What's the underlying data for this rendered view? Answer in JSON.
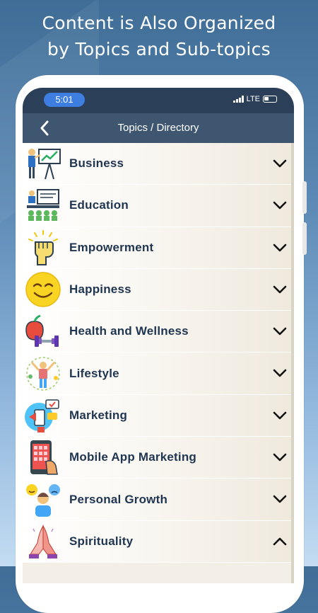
{
  "headline": {
    "line1": "Content is Also Organized",
    "line2": "by Topics and Sub-topics"
  },
  "status_bar": {
    "time": "5:01",
    "network": "LTE"
  },
  "nav": {
    "title": "Topics / Directory",
    "back_icon": "chevron-left-icon"
  },
  "topics": [
    {
      "label": "Business",
      "icon": "presentation-icon",
      "expanded": false
    },
    {
      "label": "Education",
      "icon": "classroom-icon",
      "expanded": false
    },
    {
      "label": "Empowerment",
      "icon": "raised-fist-icon",
      "expanded": false
    },
    {
      "label": "Happiness",
      "icon": "smiley-icon",
      "expanded": false
    },
    {
      "label": "Health and Wellness",
      "icon": "apple-dumbbell-icon",
      "expanded": false
    },
    {
      "label": "Lifestyle",
      "icon": "joyful-person-icon",
      "expanded": false
    },
    {
      "label": "Marketing",
      "icon": "megaphone-icon",
      "expanded": false
    },
    {
      "label": "Mobile App Marketing",
      "icon": "phone-app-icon",
      "expanded": false
    },
    {
      "label": "Personal Growth",
      "icon": "person-emoji-icon",
      "expanded": false
    },
    {
      "label": "Spirituality",
      "icon": "praying-hands-icon",
      "expanded": true
    }
  ],
  "colors": {
    "background_top": "#3f6d96",
    "nav_bar": "#3f5670",
    "status_bar": "#2b3f59",
    "label_text": "#1f3550",
    "time_pill": "#3d7ee0"
  }
}
